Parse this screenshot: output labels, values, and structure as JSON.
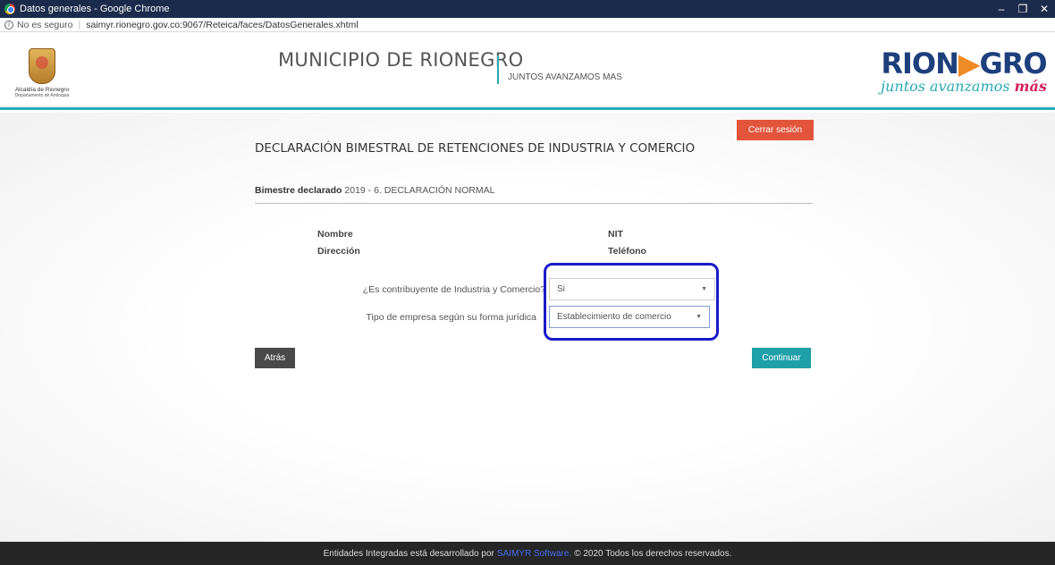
{
  "browser": {
    "window_title": "Datos generales - Google Chrome",
    "security_label": "No es seguro",
    "url": "saimyr.rionegro.gov.co:9067/Reteica/faces/DatosGenerales.xhtml",
    "controls": {
      "minimize": "–",
      "restore": "❐",
      "close": "✕"
    }
  },
  "header": {
    "crest_line1": "Alcaldía de Rionegro",
    "crest_line2": "Departamento de Antioquia",
    "title": "MUNICIPIO DE RIONEGRO",
    "slogan": "JUNTOS AVANZAMOS MAS",
    "brand_part1": "RION",
    "brand_arrow": "▶",
    "brand_part2": "GRO",
    "brand_tag_main": "juntos avanzamos ",
    "brand_tag_accent": "más"
  },
  "main": {
    "logout_label": "Cerrar sesión",
    "page_title": "DECLARACIÓN BIMESTRAL DE RETENCIONES DE INDUSTRIA Y COMERCIO",
    "period_label": "Bimestre declarado",
    "period_value": "2019 - 6. DECLARACIÓN NORMAL",
    "fields": {
      "nombre_label": "Nombre",
      "direccion_label": "Dirección",
      "nit_label": "NIT",
      "telefono_label": "Teléfono"
    },
    "questions": [
      {
        "label": "¿Es contribuyente de Industria y Comercio?",
        "selected": "Si"
      },
      {
        "label": "Tipo de empresa según su forma jurídica",
        "selected": "Establecimiento de comercio"
      }
    ],
    "back_label": "Atrás",
    "continue_label": "Continuar"
  },
  "footer": {
    "text_before": "Entidades Integradas está desarrollado por",
    "link_text": "SAIMYR Software.",
    "text_after": "© 2020 Todos los derechos reservados."
  },
  "colors": {
    "accent": "#2aa9b4",
    "logout": "#e2553c",
    "continue": "#1fa0a8",
    "highlight": "#1a1ac8"
  }
}
